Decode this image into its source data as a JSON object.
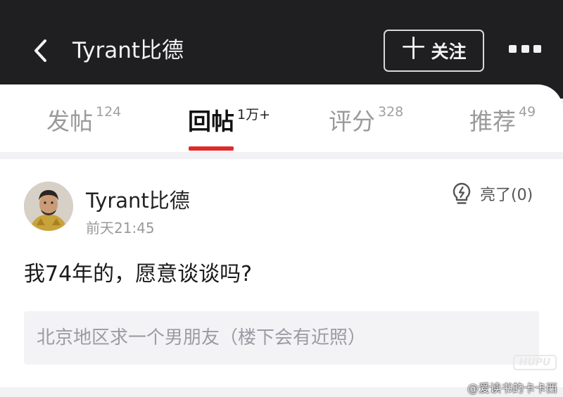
{
  "header": {
    "title": "Tyrant比德",
    "follow_plus": "十",
    "follow_label": "关注"
  },
  "tabs": [
    {
      "label": "发帖",
      "count": "124",
      "active": false
    },
    {
      "label": "回帖",
      "count": "1万+",
      "active": true
    },
    {
      "label": "评分",
      "count": "328",
      "active": false
    },
    {
      "label": "推荐",
      "count": "49",
      "active": false
    }
  ],
  "post": {
    "author": "Tyrant比德",
    "time": "前天21:45",
    "light_label": "亮了(0)",
    "content": "我74年的，愿意谈谈吗?",
    "quote": "北京地区求一个男朋友（楼下会有近照）"
  },
  "watermark": {
    "logo": "HUPU",
    "text": "@爱读书的卡卡西"
  },
  "colors": {
    "header_bg": "#1f1f21",
    "accent_red": "#e02a2a",
    "page_bg": "#f2f2f4"
  }
}
